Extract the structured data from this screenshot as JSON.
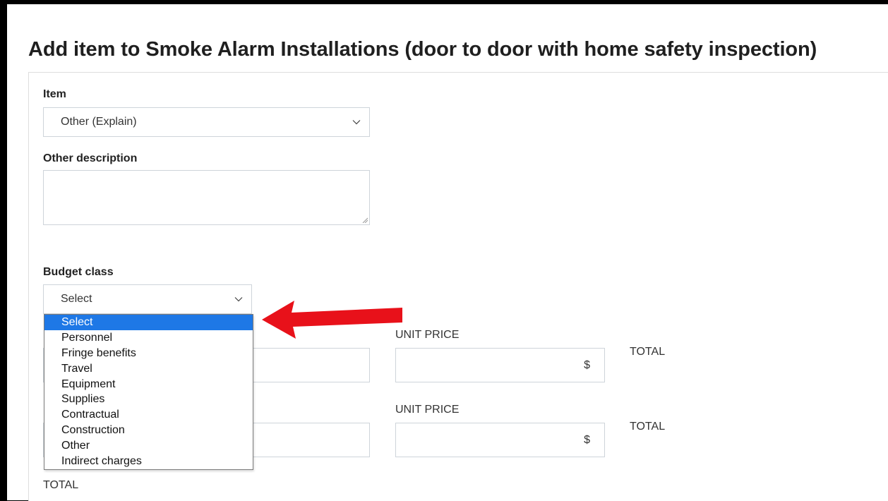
{
  "modal": {
    "title": "Add item to Smoke Alarm Installations (door to door with home safety inspection)"
  },
  "item_field": {
    "label": "Item",
    "selected": "Other (Explain)"
  },
  "other_description": {
    "label": "Other description",
    "value": ""
  },
  "budget_class": {
    "label": "Budget class",
    "selected": "Select",
    "options": [
      "Select",
      "Personnel",
      "Fringe benefits",
      "Travel",
      "Equipment",
      "Supplies",
      "Contractual",
      "Construction",
      "Other",
      "Indirect charges"
    ],
    "highlighted_index": 0
  },
  "row1": {
    "unit_price_label": "UNIT PRICE",
    "currency": "$",
    "total_label": "TOTAL"
  },
  "row2": {
    "unit_price_label": "UNIT PRICE",
    "currency": "$",
    "total_label": "TOTAL"
  },
  "footer": {
    "total_label": "TOTAL"
  },
  "annotation": {
    "arrow_color": "#e8111a"
  },
  "colors": {
    "selected_option_bg": "#1e78e6",
    "field_border": "#ced4da"
  }
}
